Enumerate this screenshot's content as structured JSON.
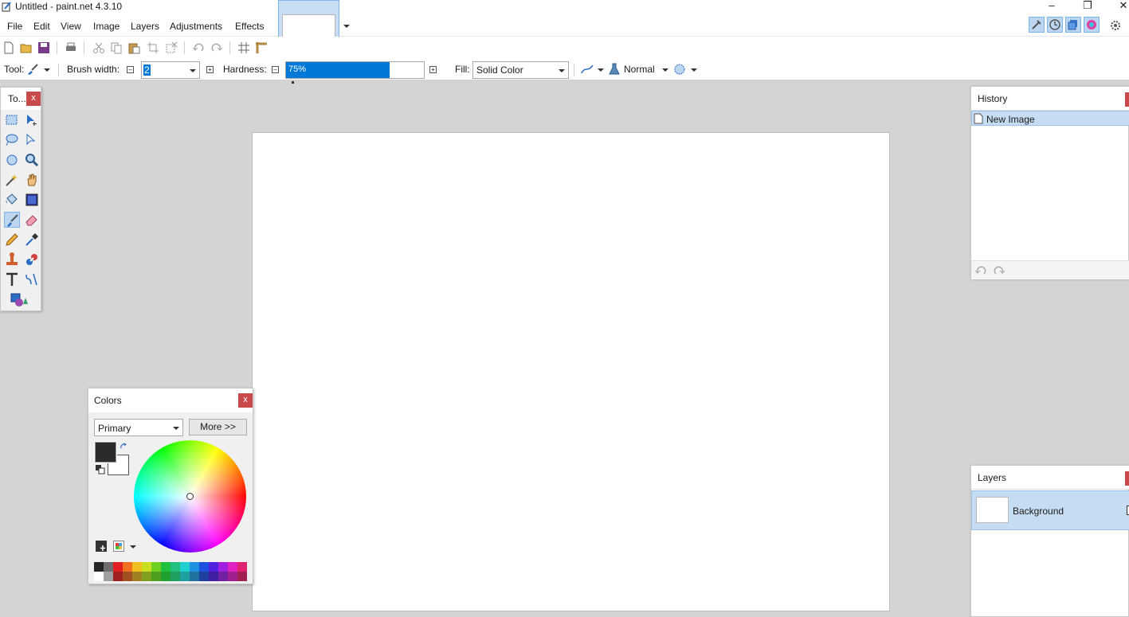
{
  "window": {
    "title": "Untitled - paint.net 4.3.10"
  },
  "menu": [
    "File",
    "Edit",
    "View",
    "Image",
    "Layers",
    "Adjustments",
    "Effects"
  ],
  "toolbar": {
    "tool_label": "Tool:",
    "brush_width_label": "Brush width:",
    "brush_width_value": "2",
    "hardness_label": "Hardness:",
    "hardness_value": "75%",
    "hardness_fraction": 0.75,
    "fill_label": "Fill:",
    "fill_value": "Solid Color",
    "blend_mode": "Normal"
  },
  "tools_panel": {
    "title": "To...",
    "close": "x",
    "tools": [
      "rectangle-select-icon",
      "move-selected-icon",
      "lasso-select-icon",
      "move-selection-icon",
      "ellipse-select-icon",
      "zoom-icon",
      "magic-wand-icon",
      "pan-icon",
      "paint-bucket-icon",
      "gradient-icon",
      "paintbrush-icon",
      "eraser-icon",
      "pencil-icon",
      "color-picker-icon",
      "clone-stamp-icon",
      "recolor-icon",
      "text-icon",
      "line-curve-icon",
      "shapes-icon"
    ],
    "active_tool": "paintbrush-icon"
  },
  "history_panel": {
    "title": "History",
    "items": [
      "New Image"
    ]
  },
  "layers_panel": {
    "title": "Layers",
    "items": [
      "Background"
    ]
  },
  "colors_panel": {
    "title": "Colors",
    "close": "x",
    "mode": "Primary",
    "more_button": "More >>",
    "primary_color": "#2b2b2b",
    "secondary_color": "#ffffff",
    "palette_top": [
      "#262626",
      "#6e6e6e",
      "#e02020",
      "#f07020",
      "#f0c020",
      "#c8e020",
      "#70d020",
      "#20c040",
      "#20c080",
      "#20d0d0",
      "#2090e0",
      "#2050e0",
      "#5020e0",
      "#a020e0",
      "#e020c0",
      "#e02070"
    ],
    "palette_bottom": [
      "#ffffff",
      "#a0a0a0",
      "#a02020",
      "#a05020",
      "#a08020",
      "#80a020",
      "#50a020",
      "#20a030",
      "#20a060",
      "#20a0a0",
      "#2070a0",
      "#2040a0",
      "#4020a0",
      "#7020a0",
      "#a02090",
      "#a02050"
    ]
  }
}
